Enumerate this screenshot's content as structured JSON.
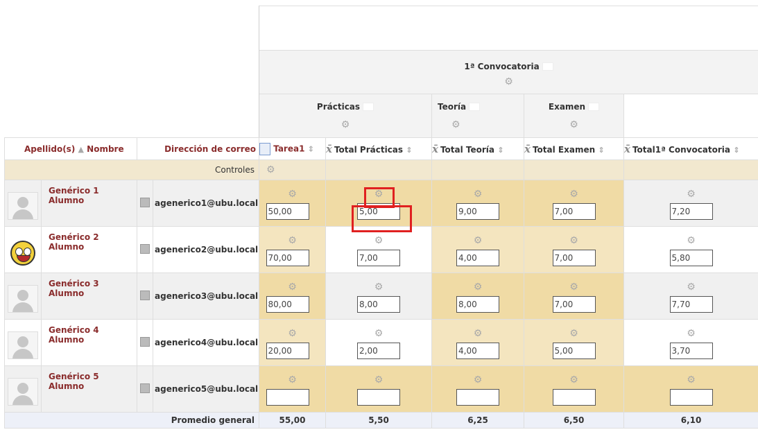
{
  "header": {
    "convocatoria": "1ª Convocatoria",
    "categories": [
      "Prácticas",
      "Teoría",
      "Examen"
    ],
    "columns": {
      "surname": "Apellido(s)",
      "name": "Nombre",
      "email": "Dirección de correo",
      "tarea1": "Tarea1",
      "total_practicas": "Total Prácticas",
      "total_teoria": "Total Teoría",
      "total_examen": "Total Examen",
      "total_convocatoria": "Total1ª Convocatoria"
    }
  },
  "controls_label": "Controles",
  "students": [
    {
      "name": "Genérico 1 Alumno",
      "email": "agenerico1@ubu.local",
      "avatar": "default-user-icon",
      "grades": [
        "50,00",
        "5,00",
        "9,00",
        "7,00",
        "7,20"
      ]
    },
    {
      "name": "Genérico 2 Alumno",
      "email": "agenerico2@ubu.local",
      "avatar": "smiley-face-icon",
      "grades": [
        "70,00",
        "7,00",
        "4,00",
        "7,00",
        "5,80"
      ]
    },
    {
      "name": "Genérico 3 Alumno",
      "email": "agenerico3@ubu.local",
      "avatar": "default-user-icon",
      "grades": [
        "80,00",
        "8,00",
        "8,00",
        "7,00",
        "7,70"
      ]
    },
    {
      "name": "Genérico 4 Alumno",
      "email": "agenerico4@ubu.local",
      "avatar": "default-user-icon",
      "grades": [
        "20,00",
        "2,00",
        "4,00",
        "5,00",
        "3,70"
      ]
    },
    {
      "name": "Genérico 5 Alumno",
      "email": "agenerico5@ubu.local",
      "avatar": "default-user-icon",
      "grades": [
        "",
        "",
        "",
        "",
        ""
      ]
    }
  ],
  "averages": {
    "label": "Promedio general",
    "values": [
      "55,00",
      "5,50",
      "6,25",
      "6,50",
      "6,10"
    ]
  },
  "colors": {
    "link": "#8a2c2c",
    "average_value": "#1e2e8a",
    "highlight": "#e02020",
    "controls_bg": "#f2e8cf"
  }
}
